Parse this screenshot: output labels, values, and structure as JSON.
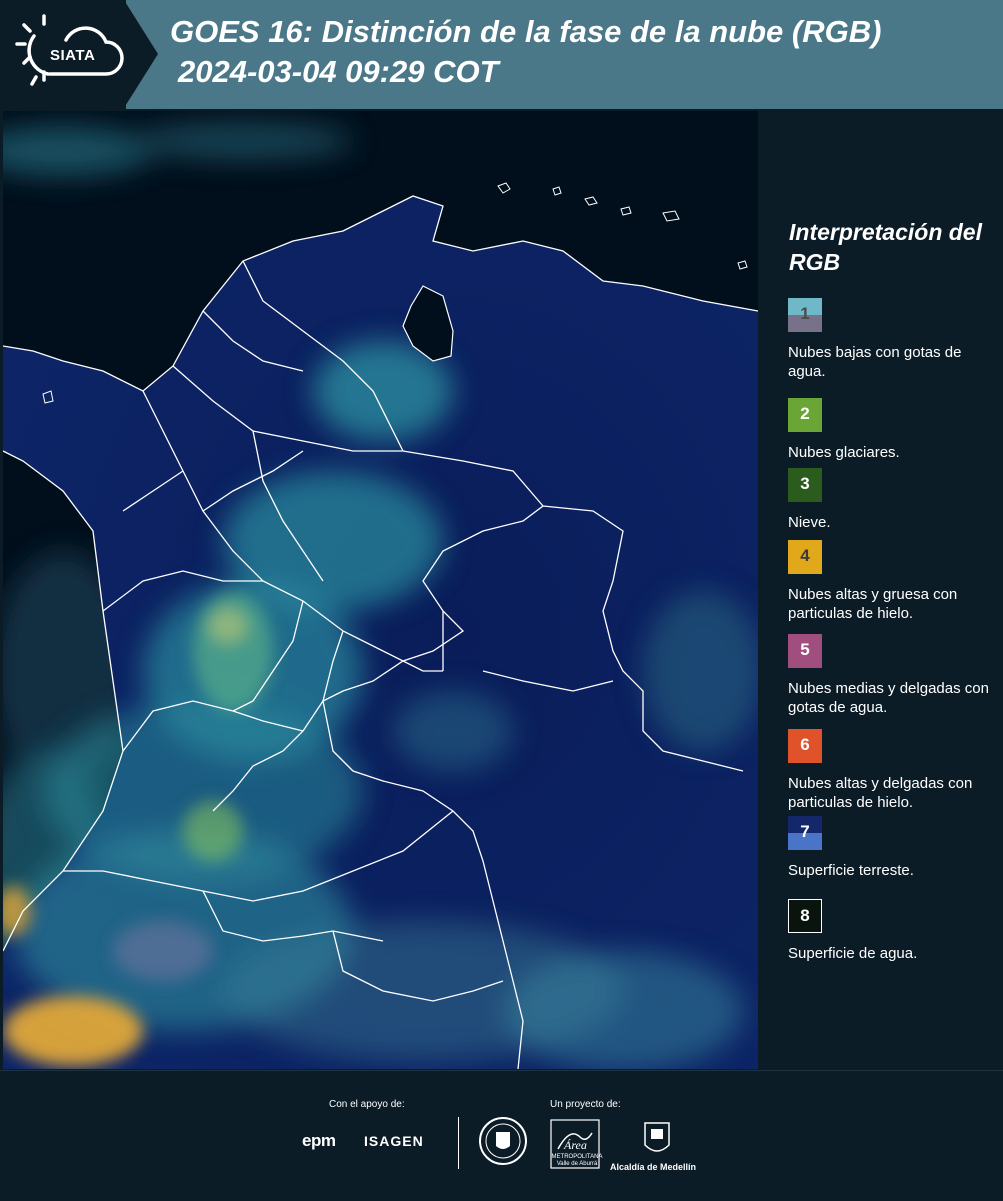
{
  "header": {
    "logo_text": "SIATA",
    "title": "GOES 16: Distinción de la fase de la nube (RGB)",
    "subtitle": "2024-03-04 09:29 COT"
  },
  "legend": {
    "title": "Interpretación del RGB",
    "items": [
      {
        "number": "1",
        "colors": [
          "#6fb8c8",
          "#78718a"
        ],
        "text_color": "#4a4a4a",
        "label": "Nubes bajas con gotas de agua."
      },
      {
        "number": "2",
        "colors": [
          "#6aa636"
        ],
        "text_color": "#ffffff",
        "label": "Nubes glaciares."
      },
      {
        "number": "3",
        "colors": [
          "#2c5c1d"
        ],
        "text_color": "#ffffff",
        "label": "Nieve."
      },
      {
        "number": "4",
        "colors": [
          "#e0a81a"
        ],
        "text_color": "#3a3a3a",
        "label": "Nubes altas y gruesa con particulas de hielo."
      },
      {
        "number": "5",
        "colors": [
          "#a04e7e"
        ],
        "text_color": "#ffffff",
        "label": "Nubes medias y delgadas con gotas de agua."
      },
      {
        "number": "6",
        "colors": [
          "#e0522a"
        ],
        "text_color": "#ffffff",
        "label": "Nubes altas y delgadas con particulas de hielo."
      },
      {
        "number": "7",
        "colors": [
          "#14276a",
          "#4a74c8"
        ],
        "text_color": "#ffffff",
        "label": "Superficie terreste."
      },
      {
        "number": "8",
        "colors": [
          "#0a140f"
        ],
        "text_color": "#ffffff",
        "label": "Superficie de agua.",
        "border": "#ffffff"
      }
    ]
  },
  "footer": {
    "support_label": "Con el apoyo de:",
    "project_label": "Un proyecto de:",
    "sponsor_1": "epm",
    "sponsor_2": "ISAGEN",
    "partner_1_text": "METROPOLITANA Valle de Aburrá",
    "partner_1_script": "Área",
    "partner_2": "Alcaldía de Medellín"
  },
  "colors": {
    "header_bg": "#4a7888",
    "panel_bg": "#0c1c27",
    "ocean": "#010f1c",
    "land": "#0d2363",
    "cloud": "#3fa8b8"
  }
}
